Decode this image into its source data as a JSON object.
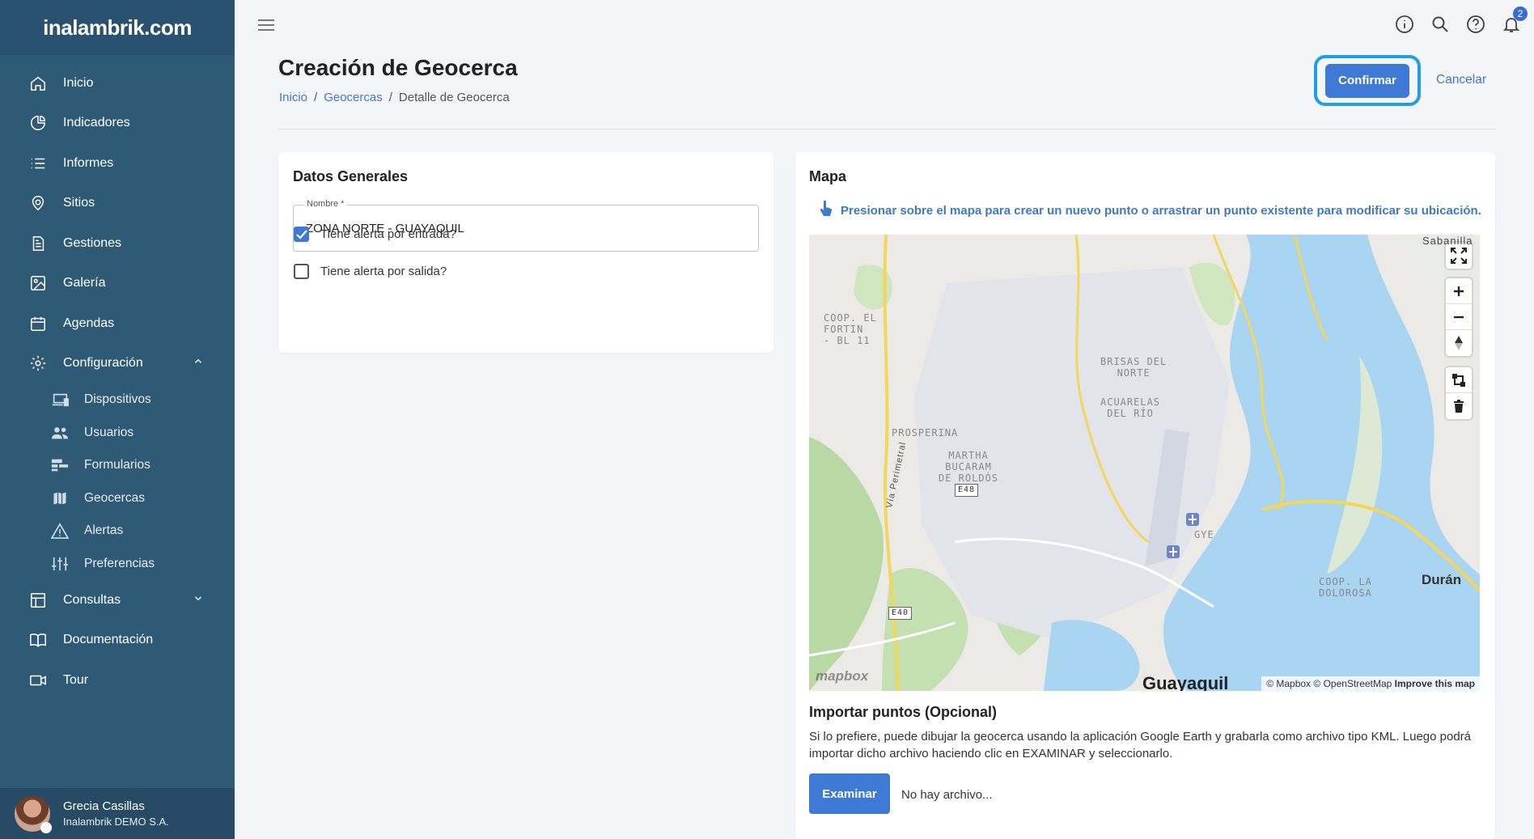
{
  "brand": {
    "name": "inalambrik.com"
  },
  "sidebar": {
    "items": [
      {
        "label": "Inicio",
        "icon": "home-icon"
      },
      {
        "label": "Indicadores",
        "icon": "pie-chart-icon"
      },
      {
        "label": "Informes",
        "icon": "list-icon"
      },
      {
        "label": "Sitios",
        "icon": "location-pin-icon"
      },
      {
        "label": "Gestiones",
        "icon": "document-icon"
      },
      {
        "label": "Galería",
        "icon": "image-icon"
      },
      {
        "label": "Agendas",
        "icon": "calendar-icon"
      },
      {
        "label": "Configuración",
        "icon": "gear-icon"
      }
    ],
    "sub_items": [
      {
        "label": "Dispositivos",
        "icon": "devices-icon"
      },
      {
        "label": "Usuarios",
        "icon": "users-icon"
      },
      {
        "label": "Formularios",
        "icon": "form-icon"
      },
      {
        "label": "Geocercas",
        "icon": "map-icon"
      },
      {
        "label": "Alertas",
        "icon": "warning-icon"
      },
      {
        "label": "Preferencias",
        "icon": "sliders-icon"
      }
    ],
    "bottom_items": [
      {
        "label": "Consultas",
        "icon": "table-icon"
      },
      {
        "label": "Documentación",
        "icon": "book-icon"
      },
      {
        "label": "Tour",
        "icon": "video-icon"
      }
    ],
    "user": {
      "name": "Grecia Casillas",
      "org": "Inalambrik DEMO S.A."
    }
  },
  "topbar": {
    "notifications_count": "2"
  },
  "header": {
    "title": "Creación de Geocerca",
    "breadcrumb": [
      "Inicio",
      "Geocercas",
      "Detalle de Geocerca"
    ],
    "confirm_label": "Confirmar",
    "cancel_label": "Cancelar"
  },
  "general": {
    "title": "Datos Generales",
    "name_label": "Nombre *",
    "name_value": "ZONA NORTE - GUAYAQUIL",
    "alert_entry_label": "Tiene alerta por entrada?",
    "alert_entry_checked": true,
    "alert_exit_label": "Tiene alerta por salida?",
    "alert_exit_checked": false
  },
  "map": {
    "title": "Mapa",
    "hint": "Presionar sobre el mapa para crear un nuevo punto o arrastrar un punto existente para modificar su ubicación.",
    "labels": {
      "coop": "COOP. EL\nFORTIN\n- BL 11",
      "brisas": "BRISAS DEL\nNORTE",
      "acuarelas": "ACUARELAS\nDEL RÍO",
      "prosperina": "PROSPERINA",
      "martha": "MARTHA\nBUCARAM\nDE ROLDÓS",
      "gye": "GYE",
      "coop_dolorosa": "COOP. LA\nDOLOROSA",
      "duran": "Durán",
      "guayaquil": "Guayaquil",
      "sabanilla": "Sabanilla",
      "perimetral": "Vía Perimetral",
      "e48": "E48",
      "e40": "E40",
      "mapbox": "mapbox",
      "attribution_mapbox": "© Mapbox",
      "attribution_osm": "© OpenStreetMap",
      "attribution_improve": "Improve this map"
    }
  },
  "import": {
    "title": "Importar puntos (Opcional)",
    "text": "Si lo prefiere, puede dibujar la geocerca usando la aplicación Google Earth y grabarla como archivo tipo KML. Luego podrá importar dicho archivo haciendo clic en EXAMINAR y seleccionarlo.",
    "button_label": "Examinar",
    "file_status": "No hay archivo..."
  },
  "colors": {
    "sidebar": "#2f5a76",
    "accent": "#3e79d6",
    "highlight": "#1e9de8",
    "water": "#a9d4f2"
  }
}
